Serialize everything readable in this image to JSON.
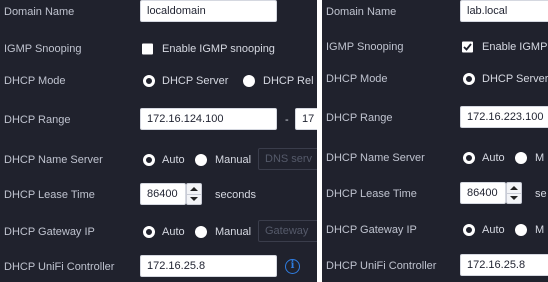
{
  "left": {
    "labels": {
      "domain_name": "Domain Name",
      "igmp_snooping": "IGMP Snooping",
      "dhcp_mode": "DHCP Mode",
      "dhcp_range": "DHCP Range",
      "dhcp_name_server": "DHCP Name Server",
      "dhcp_lease_time": "DHCP Lease Time",
      "dhcp_gateway_ip": "DHCP Gateway IP",
      "dhcp_unifi_controller": "DHCP UniFi Controller"
    },
    "domain_name_value": "localdomain",
    "igmp_checkbox_label": "Enable IGMP snooping",
    "igmp_checked": false,
    "dhcp_mode_server": "DHCP Server",
    "dhcp_mode_relay": "DHCP Rel",
    "range_start": "172.16.124.100",
    "range_separator": "-",
    "range_end": "17",
    "name_server_auto": "Auto",
    "name_server_manual": "Manual",
    "name_server_placeholder": "DNS serv",
    "lease_time_value": "86400",
    "lease_time_unit": "seconds",
    "gateway_auto": "Auto",
    "gateway_manual": "Manual",
    "gateway_placeholder": "Gateway",
    "controller_value": "172.16.25.8",
    "info_glyph": "i"
  },
  "right": {
    "labels": {
      "domain_name": "Domain Name",
      "igmp_snooping": "IGMP Snooping",
      "dhcp_mode": "DHCP Mode",
      "dhcp_range": "DHCP Range",
      "dhcp_name_server": "DHCP Name Server",
      "dhcp_lease_time": "DHCP Lease Time",
      "dhcp_gateway_ip": "DHCP Gateway IP",
      "dhcp_unifi_controller": "DHCP UniFi Controller"
    },
    "domain_name_value": "lab.local",
    "igmp_checkbox_label": "Enable IGMP",
    "igmp_checked": true,
    "dhcp_mode_server": "DHCP Server",
    "range_start": "172.16.223.100",
    "name_server_auto": "Auto",
    "name_server_manual": "M",
    "lease_time_value": "86400",
    "lease_time_unit": "se",
    "gateway_auto": "Auto",
    "gateway_manual": "M",
    "controller_value": "172.16.25.8"
  },
  "colors": {
    "panel_bg": "#20222d",
    "label": "#bfc3cf",
    "info_blue": "#2f7de1"
  }
}
